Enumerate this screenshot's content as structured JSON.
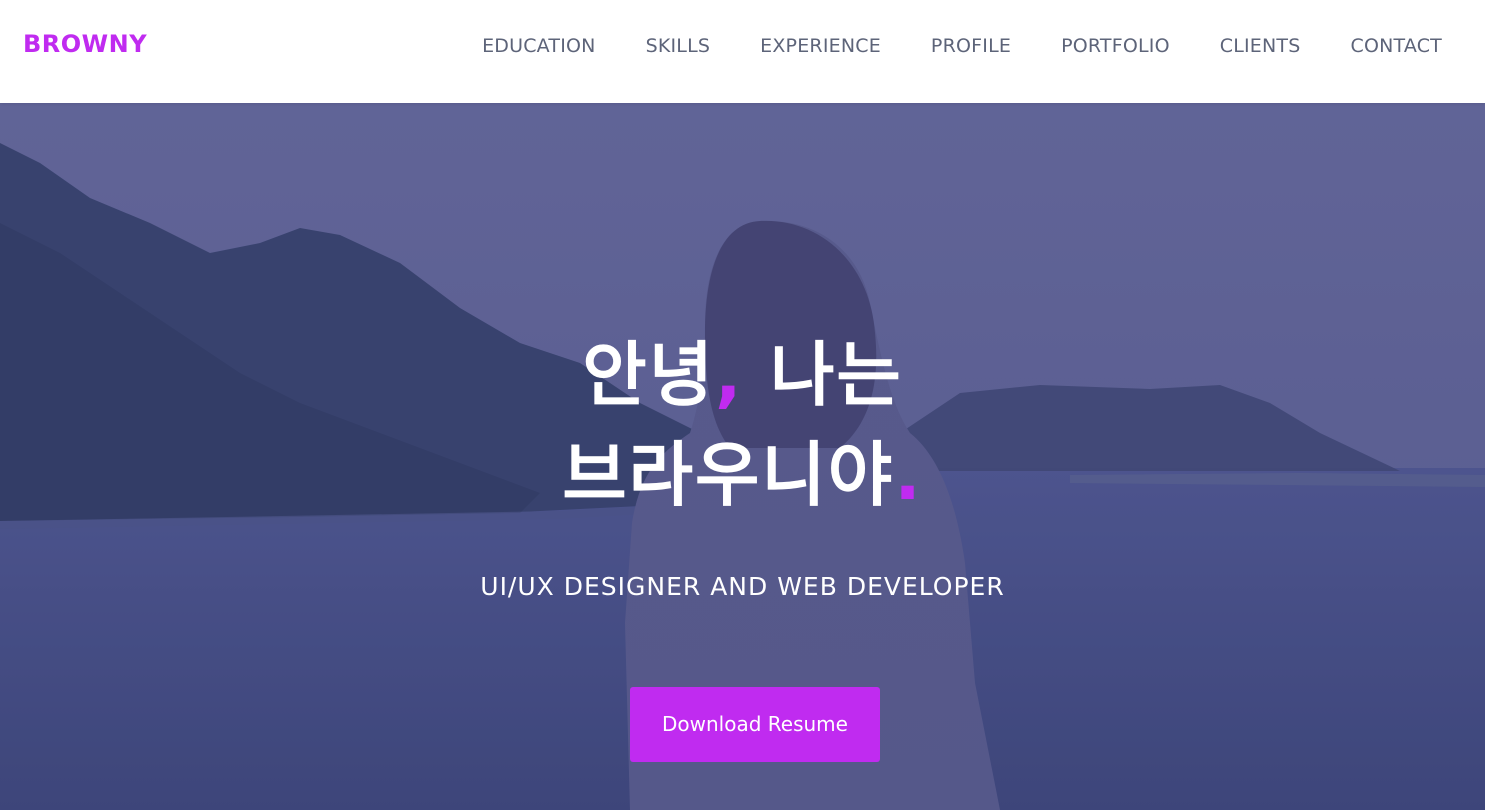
{
  "header": {
    "brand": "BROWNY",
    "nav": [
      {
        "label": "EDUCATION"
      },
      {
        "label": "SKILLS"
      },
      {
        "label": "EXPERIENCE"
      },
      {
        "label": "PROFILE"
      },
      {
        "label": "PORTFOLIO"
      },
      {
        "label": "CLIENTS"
      },
      {
        "label": "CONTACT"
      }
    ]
  },
  "hero": {
    "line1_a": "안녕",
    "line1_comma": ",",
    "line1_b": " 나는",
    "line2_a": "브라우니야",
    "line2_dot": ".",
    "subtitle": "UI/UX DESIGNER AND WEB DEVELOPER",
    "cta_label": "Download Resume"
  },
  "colors": {
    "accent": "#c02bf0",
    "nav_text": "#5d6479",
    "overlay": "#4c4f86"
  }
}
